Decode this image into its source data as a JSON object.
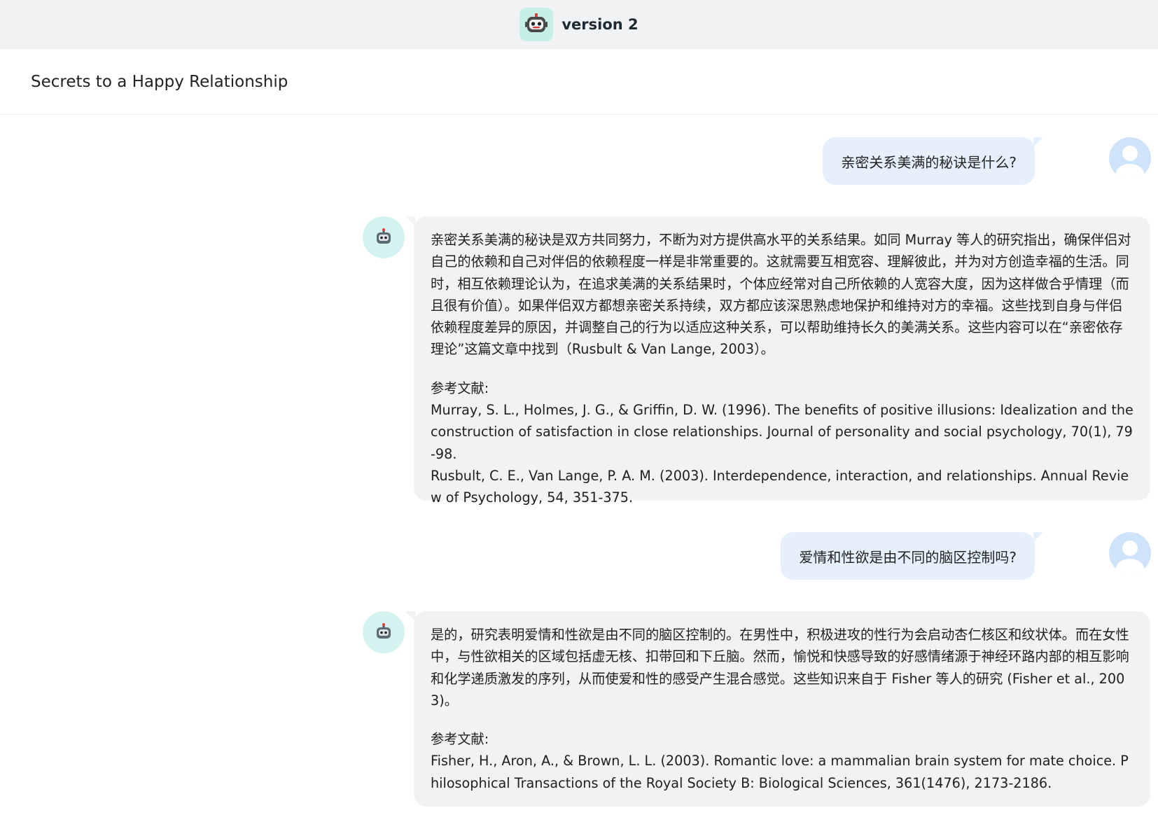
{
  "header": {
    "app_name": "version 2",
    "icon": "robot-icon"
  },
  "conversation": {
    "title": "Secrets to a Happy Relationship"
  },
  "messages": [
    {
      "role": "user",
      "text": "亲密关系美满的秘诀是什么?"
    },
    {
      "role": "assistant",
      "body": "亲密关系美满的秘诀是双方共同努力，不断为对方提供高水平的关系结果。如同 Murray 等人的研究指出，确保伴侣对自己的依赖和自己对伴侣的依赖程度一样是非常重要的。这就需要互相宽容、理解彼此，并为对方创造幸福的生活。同时，相互依赖理论认为，在追求美满的关系结果时，个体应经常对自己所依赖的人宽容大度，因为这样做合乎情理（而且很有价值）。如果伴侣双方都想亲密关系持续，双方都应该深思熟虑地保护和维持对方的幸福。这些找到自身与伴侣依赖程度差异的原因，并调整自己的行为以适应这种关系，可以帮助维持长久的美满关系。这些内容可以在“亲密依存理论”这篇文章中找到（Rusbult & Van Lange, 2003）。",
      "refs_label": "参考文献:",
      "refs": [
        "Murray, S. L., Holmes, J. G., & Griffin, D. W. (1996). The benefits of positive illusions: Idealization and the construction of satisfaction in close relationships. Journal of personality and social psychology, 70(1), 79-98.",
        "Rusbult, C. E., Van Lange, P. A. M. (2003). Interdependence, interaction, and relationships. Annual Review of Psychology, 54, 351-375."
      ]
    },
    {
      "role": "user",
      "text": "爱情和性欲是由不同的脑区控制吗?"
    },
    {
      "role": "assistant",
      "body": "是的，研究表明爱情和性欲是由不同的脑区控制的。在男性中，积极进攻的性行为会启动杏仁核区和纹状体。而在女性中，与性欲相关的区域包括虚无核、扣带回和下丘脑。然而，愉悦和快感导致的好感情绪源于神经环路内部的相互影响和化学递质激发的序列，从而使爱和性的感受产生混合感觉。这些知识来自于 Fisher 等人的研究 (Fisher et al., 2003)。",
      "refs_label": "参考文献:",
      "refs": [
        "Fisher, H., Aron, A., & Brown, L. L. (2003). Romantic love: a mammalian brain system for mate choice. Philosophical Transactions of the Royal Society B: Biological Sciences, 361(1476), 2173-2186."
      ]
    }
  ],
  "colors": {
    "header_bg": "#f1f2f4",
    "user_bubble": "#e6f0fd",
    "assistant_bubble": "#f1f2f4",
    "bot_avatar_bg": "#d4f3f0",
    "user_avatar_bg": "#cfe3fb"
  }
}
